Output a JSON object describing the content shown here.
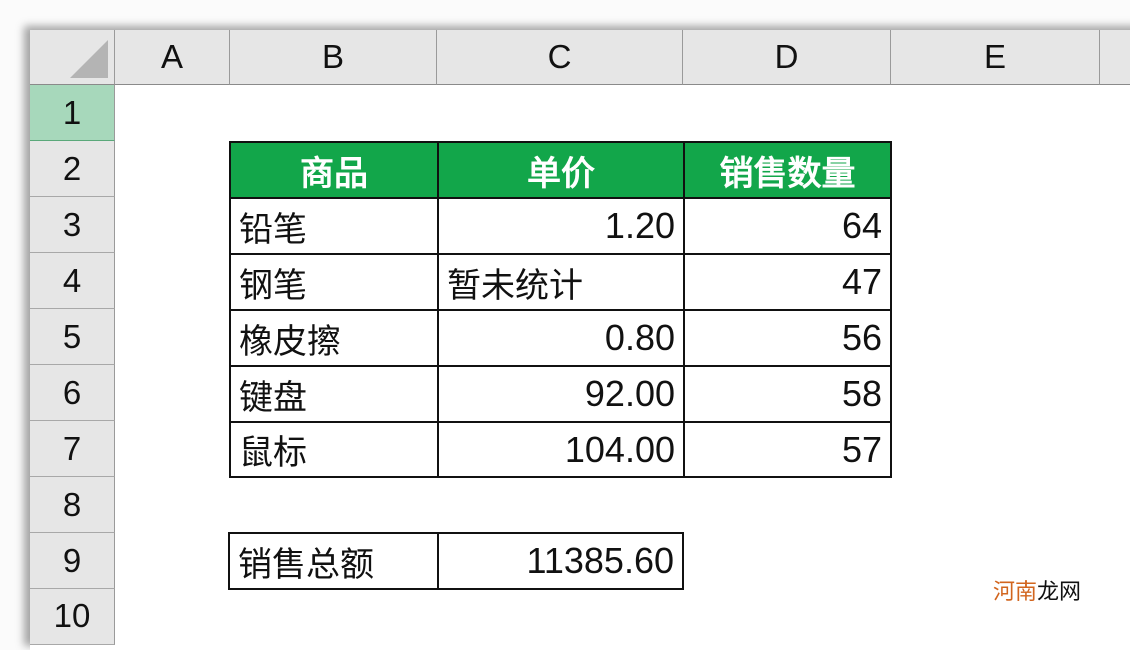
{
  "spreadsheet": {
    "columns": [
      "A",
      "B",
      "C",
      "D",
      "E"
    ],
    "rows": [
      "1",
      "2",
      "3",
      "4",
      "5",
      "6",
      "7",
      "8",
      "9",
      "10"
    ],
    "selected_row": "1",
    "header_color": "#12a64a",
    "table": {
      "headers": [
        "商品",
        "单价",
        "销售数量"
      ],
      "rows": [
        {
          "item": "铅笔",
          "price": "1.20",
          "qty": "64"
        },
        {
          "item": "钢笔",
          "price": "暂未统计",
          "qty": "47"
        },
        {
          "item": "橡皮擦",
          "price": "0.80",
          "qty": "56"
        },
        {
          "item": "键盘",
          "price": "92.00",
          "qty": "58"
        },
        {
          "item": "鼠标",
          "price": "104.00",
          "qty": "57"
        }
      ]
    },
    "summary": {
      "label": "销售总额",
      "value": "11385.60"
    }
  },
  "watermark": {
    "part1": "河南",
    "part2": "龙网"
  }
}
